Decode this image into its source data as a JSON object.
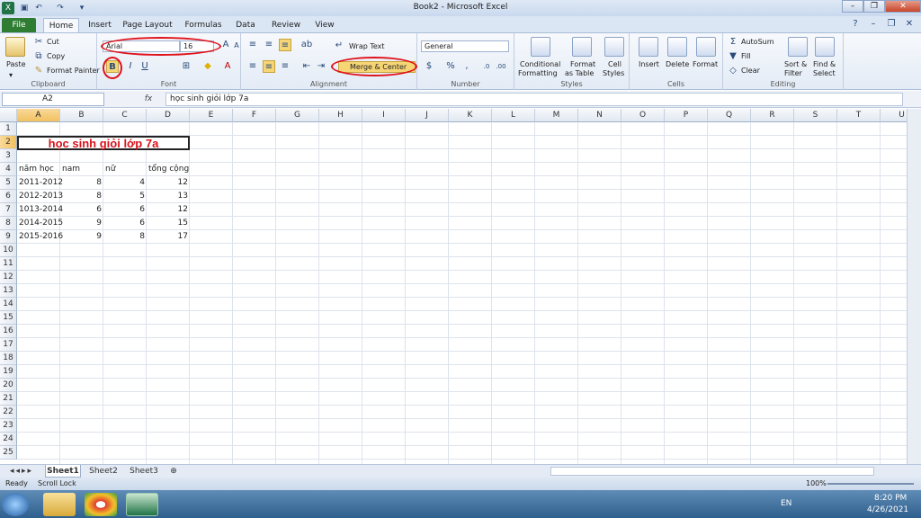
{
  "window": {
    "title": "Book2 - Microsoft Excel"
  },
  "tabs": [
    "File",
    "Home",
    "Insert",
    "Page Layout",
    "Formulas",
    "Data",
    "Review",
    "View"
  ],
  "ribbon": {
    "clipboard": {
      "paste": "Paste",
      "cut": "Cut",
      "copy": "Copy",
      "format_painter": "Format Painter",
      "label": "Clipboard"
    },
    "font": {
      "name": "Arial",
      "size": "16",
      "bold": "B",
      "italic": "I",
      "underline": "U",
      "label": "Font"
    },
    "alignment": {
      "wrap": "Wrap Text",
      "merge": "Merge & Center",
      "label": "Alignment"
    },
    "number": {
      "format": "General",
      "currency": "$",
      "percent": "%",
      "comma": ",",
      "label": "Number"
    },
    "styles": {
      "conditional": "Conditional",
      "formatting": "Formatting",
      "format_as": "Format",
      "as_table": "as Table",
      "cell": "Cell",
      "cell_styles": "Styles",
      "label": "Styles"
    },
    "cells": {
      "insert": "Insert",
      "delete": "Delete",
      "format": "Format",
      "label": "Cells"
    },
    "editing": {
      "autosum": "AutoSum",
      "fill": "Fill",
      "clear": "Clear",
      "sort": "Sort &",
      "filter": "Filter",
      "find": "Find &",
      "select": "Select",
      "label": "Editing"
    }
  },
  "formula_bar": {
    "name_box": "A2",
    "fx": "fx",
    "content": "học sinh giỏi lớp 7a"
  },
  "columns": [
    "A",
    "B",
    "C",
    "D",
    "E",
    "F",
    "G",
    "H",
    "I",
    "J",
    "K",
    "L",
    "M",
    "N",
    "O",
    "P",
    "Q",
    "R",
    "S",
    "T",
    "U"
  ],
  "rows": [
    "1",
    "2",
    "3",
    "4",
    "5",
    "6",
    "7",
    "8",
    "9",
    "10",
    "11",
    "12",
    "13",
    "14",
    "15",
    "16",
    "17",
    "18",
    "19",
    "20",
    "21",
    "22",
    "23",
    "24",
    "25"
  ],
  "sheet": {
    "title": "học sinh giỏi lớp 7a",
    "headers": [
      "năm học",
      "nam",
      "nữ",
      "tổng cộng"
    ],
    "data": [
      [
        "2011-2012",
        "8",
        "4",
        "12"
      ],
      [
        "2012-2013",
        "8",
        "5",
        "13"
      ],
      [
        "1013-2014",
        "6",
        "6",
        "12"
      ],
      [
        "2014-2015",
        "9",
        "6",
        "15"
      ],
      [
        "2015-2016",
        "9",
        "8",
        "17"
      ]
    ]
  },
  "sheet_tabs": [
    "Sheet1",
    "Sheet2",
    "Sheet3"
  ],
  "status": {
    "ready": "Ready",
    "scroll_lock": "Scroll Lock",
    "zoom": "100%"
  },
  "taskbar": {
    "lang": "EN",
    "time": "8:20 PM",
    "date": "4/26/2021"
  }
}
